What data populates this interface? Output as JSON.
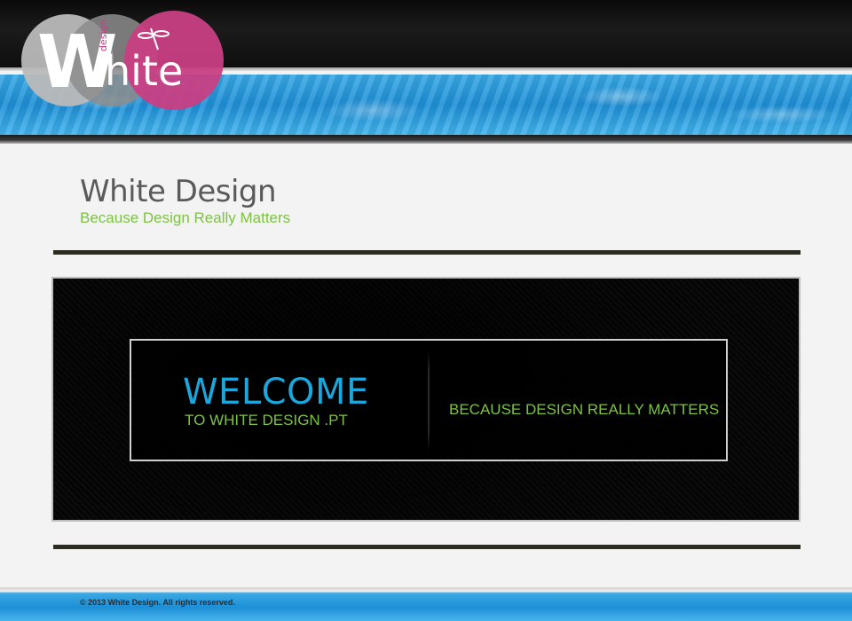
{
  "header": {
    "logo_main": "hite",
    "logo_letter": "W",
    "logo_small": "design"
  },
  "content": {
    "site_title": "White Design",
    "tagline": "Because Design Really Matters"
  },
  "banner": {
    "welcome": "WELCOME",
    "welcome_sub": "TO WHITE DESIGN .PT",
    "tagline": "BECAUSE DESIGN REALLY MATTERS"
  },
  "footer": {
    "copyright": "© 2013 White Design. All rights reserved."
  },
  "colors": {
    "accent_blue": "#1ba6dc",
    "accent_green": "#7dc242",
    "logo_pink": "#c83f83"
  }
}
